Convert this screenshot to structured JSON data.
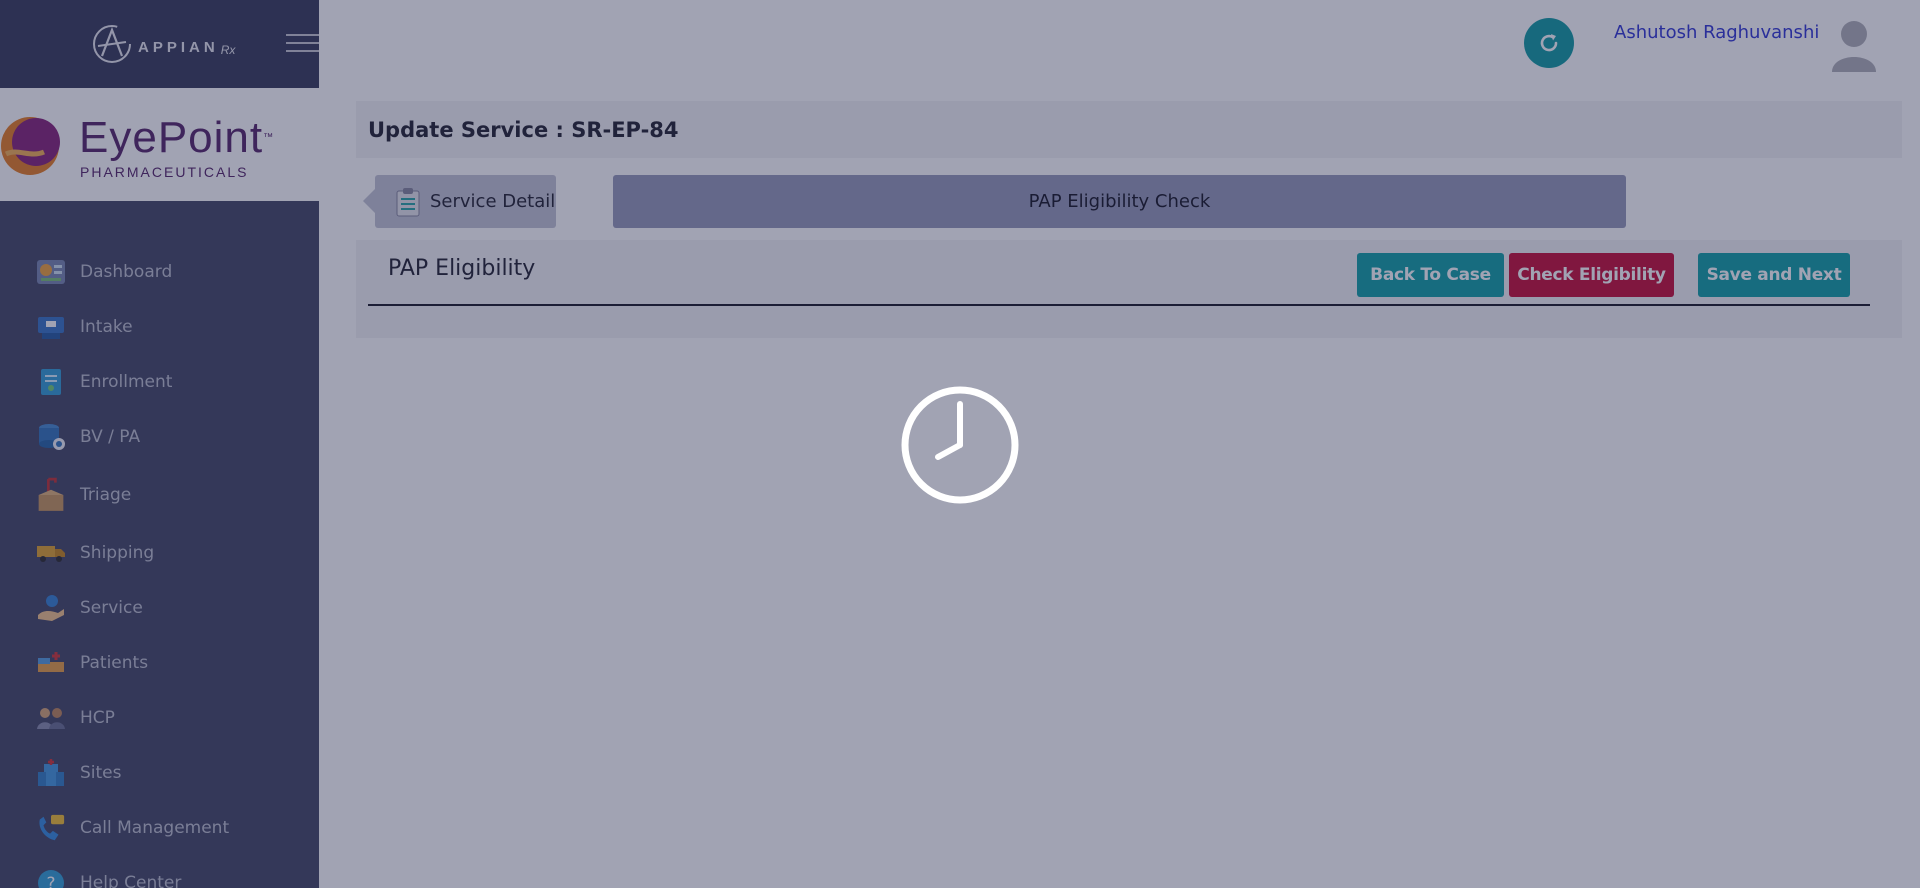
{
  "brand": {
    "platform_name": "APPIAN",
    "platform_suffix": "Rx",
    "client_name": "EyePoint",
    "client_tm": "™",
    "client_subtitle": "PHARMACEUTICALS"
  },
  "header": {
    "user_name": "Ashutosh Raghuvanshi"
  },
  "sidebar": {
    "items": [
      {
        "label": "Dashboard",
        "icon": "dashboard-icon"
      },
      {
        "label": "Intake",
        "icon": "intake-icon"
      },
      {
        "label": "Enrollment",
        "icon": "enrollment-icon"
      },
      {
        "label": "BV / PA",
        "icon": "bv-pa-icon"
      },
      {
        "label": "Triage",
        "icon": "triage-icon"
      },
      {
        "label": "Shipping",
        "icon": "shipping-icon"
      },
      {
        "label": "Service",
        "icon": "service-icon"
      },
      {
        "label": "Patients",
        "icon": "patients-icon"
      },
      {
        "label": "HCP",
        "icon": "hcp-icon"
      },
      {
        "label": "Sites",
        "icon": "sites-icon"
      },
      {
        "label": "Call Management",
        "icon": "call-management-icon"
      },
      {
        "label": "Help Center",
        "icon": "help-center-icon"
      }
    ]
  },
  "main": {
    "title": "Update Service : SR-EP-84",
    "steps": {
      "previous": "Service Detail",
      "current": "PAP Eligibility Check"
    },
    "panel": {
      "heading": "PAP Eligibility",
      "buttons": {
        "back": "Back To Case",
        "check": "Check Eligibility",
        "save": "Save and Next"
      }
    }
  },
  "overlay": {
    "state": "loading",
    "icon": "clock-icon"
  },
  "colors": {
    "sidebar_bg": "#4a4d6a",
    "accent_teal": "#19a4a8",
    "accent_red": "#c8173f",
    "brand_purple": "#5c2d6f",
    "username_blue": "#3a3fd6"
  }
}
